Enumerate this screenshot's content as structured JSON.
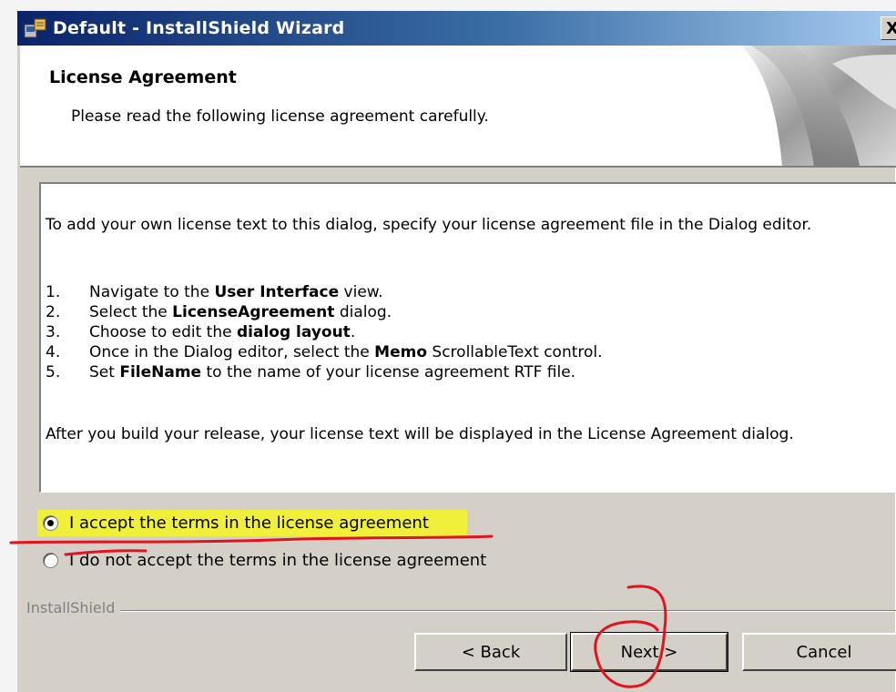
{
  "window": {
    "title": "Default - InstallShield Wizard",
    "close_glyph": "X"
  },
  "header": {
    "title": "License Agreement",
    "subtitle": "Please read the following license agreement carefully."
  },
  "license": {
    "intro": "To add your own license text to this dialog, specify your license agreement file in the Dialog editor.",
    "steps": [
      {
        "num": "1.",
        "pre": "Navigate to the ",
        "bold": "User Interface",
        "post": " view."
      },
      {
        "num": "2.",
        "pre": "Select the ",
        "bold": "LicenseAgreement",
        "post": " dialog."
      },
      {
        "num": "3.",
        "pre": "Choose to edit the ",
        "bold": "dialog layout",
        "post": "."
      },
      {
        "num": "4.",
        "pre": "Once in the Dialog editor, select the ",
        "bold": "Memo",
        "post": " ScrollableText control."
      },
      {
        "num": "5.",
        "pre": "Set ",
        "bold": "FileName",
        "post": " to the name of your license agreement RTF file."
      }
    ],
    "outro": "After you build your release, your license text will be displayed in the License Agreement dialog."
  },
  "options": {
    "accept_label": "I accept the terms in the license agreement",
    "decline_label": "I do not accept the terms in the license agreement",
    "selected": "accept"
  },
  "footer": {
    "brand": "InstallShield",
    "back_label": "< Back",
    "next_label": "Next >",
    "cancel_label": "Cancel"
  },
  "colors": {
    "title_bar": "#0a246a",
    "dialog_face": "#d4d0c8",
    "highlight": "#f0ef3a",
    "annotation": "#e0141e"
  },
  "icons": {
    "app_icon": "installer-package-icon",
    "close_icon": "close-icon"
  }
}
